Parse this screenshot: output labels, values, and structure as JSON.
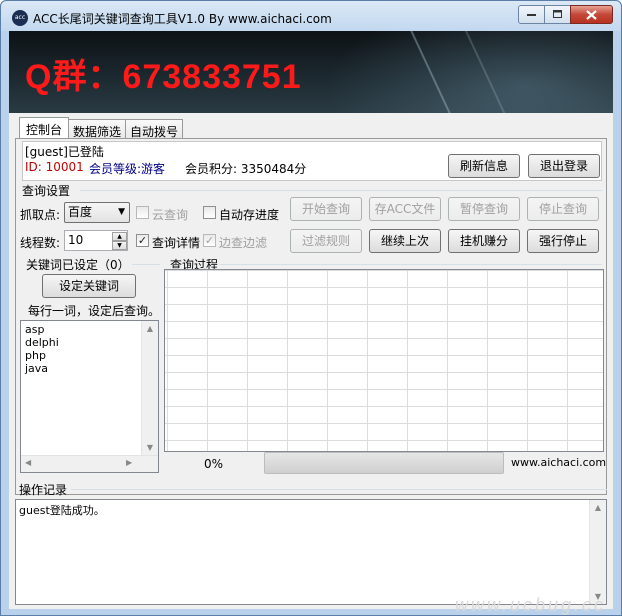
{
  "window": {
    "title": "ACC长尾词关键词查询工具V1.0  By  www.aichaci.com",
    "icon_name": "acc-app-icon"
  },
  "banner": {
    "text": "Q群：673833751",
    "text_color": "#ff1a1a"
  },
  "tabs": [
    {
      "label": "控制台",
      "active": true
    },
    {
      "label": "数据筛选",
      "active": false
    },
    {
      "label": "自动拨号",
      "active": false
    }
  ],
  "user": {
    "status": "[guest]已登陆",
    "id_text": "ID: 10001",
    "level_text": "会员等级:游客",
    "points_text": "会员积分: 3350484分",
    "refresh_label": "刷新信息",
    "logout_label": "退出登录"
  },
  "query_settings": {
    "group_label": "查询设置",
    "source_label": "抓取点:",
    "source_value": "百度",
    "cloud_label": "云查询",
    "cloud_checked": false,
    "autosave_label": "自动存进度",
    "autosave_checked": false,
    "threads_label": "线程数:",
    "threads_value": "10",
    "detail_label": "查询详情",
    "detail_checked": true,
    "filter_edge_label": "边查边滤",
    "filter_edge_checked": true,
    "buttons": {
      "start": "开始查询",
      "save_acc": "存ACC文件",
      "pause": "暂停查询",
      "stop": "停止查询",
      "filter_rules": "过滤规则",
      "continue_last": "继续上次",
      "hang_earn": "挂机赚分",
      "force_stop": "强行停止"
    }
  },
  "keywords": {
    "group_label": "关键词已设定（0）",
    "set_button": "设定关键词",
    "hint": "每行一词，设定后查询。",
    "items": [
      "asp",
      "delphi",
      "php",
      "java"
    ]
  },
  "process": {
    "group_label": "查询过程",
    "progress_text": "0%",
    "progress_value": 0,
    "site": "www.aichaci.com"
  },
  "log": {
    "group_label": "操作记录",
    "lines": [
      "guest登陆成功。"
    ]
  },
  "watermark": "www.ucbug.cc"
}
